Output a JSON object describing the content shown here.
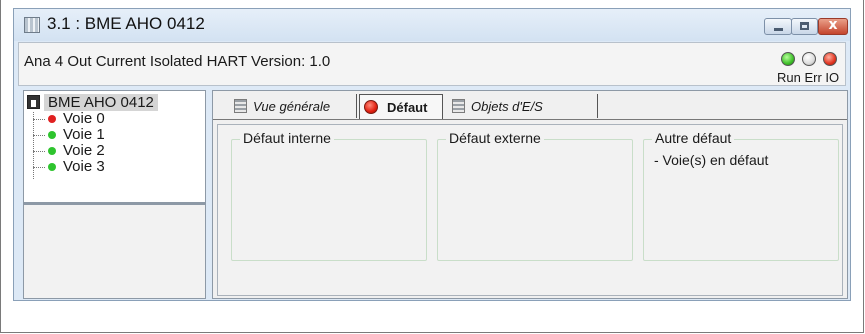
{
  "window": {
    "title": "3.1 : BME AHO 0412",
    "app_icon": "module-icon",
    "buttons": [
      "minimize",
      "maximize",
      "close"
    ],
    "close_glyph": "x"
  },
  "device": {
    "description": "Ana 4 Out Current Isolated HART Version: 1.0",
    "status_leds": [
      {
        "name": "Run",
        "color": "#3fbf2a"
      },
      {
        "name": "Err",
        "color": "#dcdcdc"
      },
      {
        "name": "IO",
        "color": "#e23420"
      }
    ],
    "status_labels": "Run Err IO"
  },
  "tree": {
    "root": "BME AHO 0412",
    "items": [
      {
        "label": "Voie 0",
        "status_color": "#e02020"
      },
      {
        "label": "Voie 1",
        "status_color": "#2ec42e"
      },
      {
        "label": "Voie 2",
        "status_color": "#2ec42e"
      },
      {
        "label": "Voie 3",
        "status_color": "#2ec42e"
      }
    ]
  },
  "tabs": [
    {
      "label": "Vue générale",
      "icon": "document-icon",
      "active": false
    },
    {
      "label": "Défaut",
      "icon": "red-status-icon",
      "active": true
    },
    {
      "label": "Objets d'E/S",
      "icon": "document-icon",
      "active": false
    }
  ],
  "fault_groups": [
    {
      "title": "Défaut interne",
      "lines": []
    },
    {
      "title": "Défaut externe",
      "lines": []
    },
    {
      "title": "Autre défaut",
      "lines": [
        "- Voie(s) en défaut"
      ]
    }
  ]
}
